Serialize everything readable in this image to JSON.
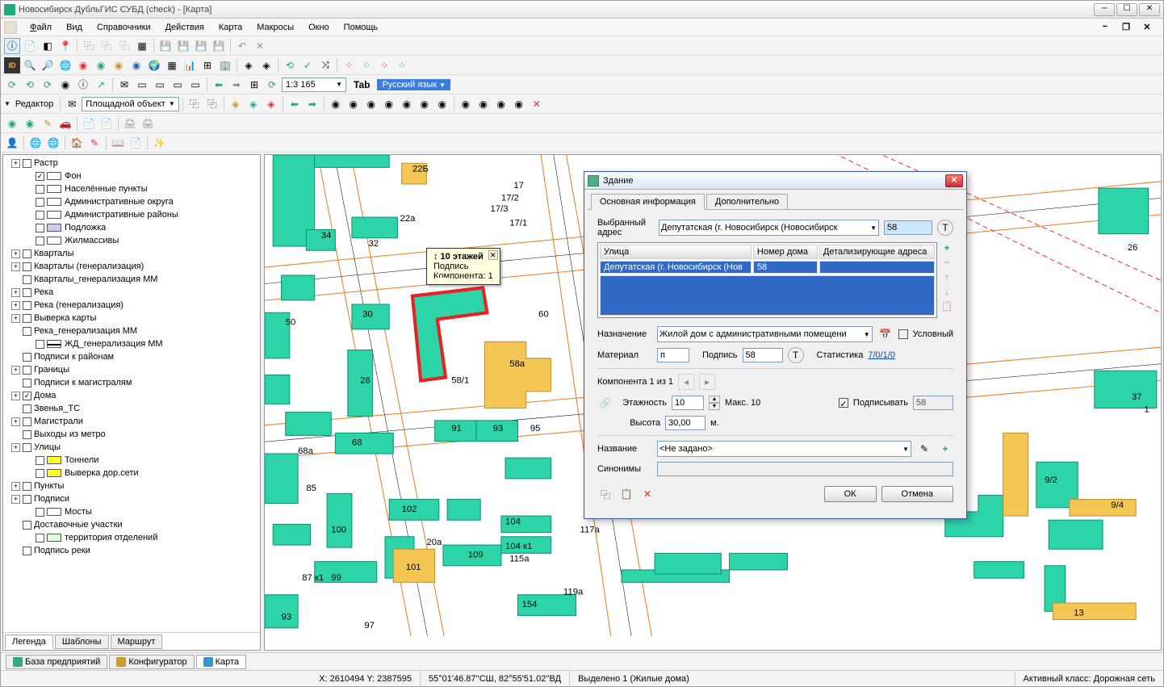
{
  "title": "Новосибирск ДубльГИС СУБД (check) - [Карта]",
  "menu": [
    "Файл",
    "Вид",
    "Справочники",
    "Действия",
    "Карта",
    "Макросы",
    "Окно",
    "Помощь"
  ],
  "editor_label": "Редактор",
  "area_object": "Площадной объект",
  "scale": "1:3 165",
  "tab_key": "Tab",
  "language": "Русский язык",
  "tooltip": {
    "title": "↕ 10 этажей",
    "l1": "Подпись",
    "l2": "Компонента: 1"
  },
  "layers": [
    {
      "exp": "+",
      "cb": "",
      "sw": "",
      "name": "Растр",
      "indent": 0
    },
    {
      "exp": "",
      "cb": "✓",
      "sw": "#fff",
      "name": "Фон",
      "indent": 1
    },
    {
      "exp": "",
      "cb": "",
      "sw": "#fff",
      "name": "Населённые пункты",
      "indent": 1
    },
    {
      "exp": "",
      "cb": "",
      "sw": "#fff",
      "name": "Административные округа",
      "indent": 1
    },
    {
      "exp": "",
      "cb": "",
      "sw": "#fff",
      "name": "Административные районы",
      "indent": 1
    },
    {
      "exp": "",
      "cb": "",
      "sw": "#cce",
      "name": "Подложка",
      "indent": 1
    },
    {
      "exp": "",
      "cb": "",
      "sw": "#fff",
      "name": "Жилмассивы",
      "indent": 1
    },
    {
      "exp": "+",
      "cb": "",
      "sw": "",
      "name": "Кварталы",
      "indent": 0
    },
    {
      "exp": "+",
      "cb": "",
      "sw": "",
      "name": "Кварталы (генерализация)",
      "indent": 0
    },
    {
      "exp": "",
      "cb": "",
      "sw": "",
      "name": "Кварталы_генерализация ММ",
      "indent": 0
    },
    {
      "exp": "+",
      "cb": "",
      "sw": "",
      "name": "Река",
      "indent": 0
    },
    {
      "exp": "+",
      "cb": "",
      "sw": "",
      "name": "Река (генерализация)",
      "indent": 0
    },
    {
      "exp": "+",
      "cb": "",
      "sw": "",
      "name": "Выверка карты",
      "indent": 0
    },
    {
      "exp": "",
      "cb": "",
      "sw": "",
      "name": "Река_генерализация ММ",
      "indent": 0
    },
    {
      "exp": "",
      "cb": "",
      "sw": "—",
      "name": "ЖД_генерализация ММ",
      "indent": 1
    },
    {
      "exp": "",
      "cb": "",
      "sw": "",
      "name": "Подписи к районам",
      "indent": 0
    },
    {
      "exp": "+",
      "cb": "",
      "sw": "",
      "name": "Границы",
      "indent": 0
    },
    {
      "exp": "",
      "cb": "",
      "sw": "",
      "name": "Подписи к магистралям",
      "indent": 0
    },
    {
      "exp": "+",
      "cb": "✓",
      "sw": "",
      "name": "Дома",
      "indent": 0
    },
    {
      "exp": "",
      "cb": "",
      "sw": "",
      "name": "Звенья_ТС",
      "indent": 0
    },
    {
      "exp": "+",
      "cb": "",
      "sw": "",
      "name": "Магистрали",
      "indent": 0
    },
    {
      "exp": "",
      "cb": "",
      "sw": "",
      "name": "Выходы из метро",
      "indent": 0
    },
    {
      "exp": "+",
      "cb": "",
      "sw": "",
      "name": "Улицы",
      "indent": 0
    },
    {
      "exp": "",
      "cb": "",
      "sw": "#ff3",
      "name": "Тоннели",
      "indent": 1
    },
    {
      "exp": "",
      "cb": "",
      "sw": "#ff3",
      "name": "Выверка дор.сети",
      "indent": 1
    },
    {
      "exp": "+",
      "cb": "",
      "sw": "",
      "name": "Пункты",
      "indent": 0
    },
    {
      "exp": "+",
      "cb": "",
      "sw": "",
      "name": "Подписи",
      "indent": 0
    },
    {
      "exp": "",
      "cb": "",
      "sw": "#fff",
      "name": "Мосты",
      "indent": 1
    },
    {
      "exp": "",
      "cb": "",
      "sw": "",
      "name": "Доставочные участки",
      "indent": 0
    },
    {
      "exp": "",
      "cb": "",
      "sw": "#dfd",
      "name": "территория отделений",
      "indent": 1
    },
    {
      "exp": "",
      "cb": "",
      "sw": "",
      "name": "Подпись реки",
      "indent": 0
    }
  ],
  "side_tabs": [
    "Легенда",
    "Шаблоны",
    "Маршрут"
  ],
  "bottom_tabs": [
    {
      "icon": "#3a7",
      "label": "База предприятий"
    },
    {
      "icon": "#c93",
      "label": "Конфигуратор"
    },
    {
      "icon": "#39c",
      "label": "Карта"
    }
  ],
  "status": {
    "xy": "X: 2610494 Y: 2387595",
    "coords": "55°01'46.87''СШ, 82°55'51.02''ВД",
    "sel": "Выделено 1 (Жилые дома)",
    "class": "Активный класс: Дорожная сеть"
  },
  "dialog": {
    "title": "Здание",
    "tabs": [
      "Основная информация",
      "Дополнительно"
    ],
    "addr_label": "Выбранный адрес",
    "addr_value": "Депутатская (г. Новосибирск (Новосибирск",
    "addr_num": "58",
    "cols": [
      "Улица",
      "Номер дома",
      "Детализирующие адреса"
    ],
    "row": {
      "street": "Депутатская (г. Новосибирск (Нов",
      "num": "58",
      "det": ""
    },
    "purpose_label": "Назначение",
    "purpose_value": "Жилой дом с административными помещени",
    "conditional": "Условный",
    "material_label": "Материал",
    "material_value": "п",
    "sign_label": "Подпись",
    "sign_value": "58",
    "stats_label": "Статистика",
    "stats_value": "7/0/1/0",
    "component": "Компонента 1 из 1",
    "floors_label": "Этажность",
    "floors_value": "10",
    "max_label": "Макс. 10",
    "subscribe": "Подписывать",
    "subscribe_val": "58",
    "height_label": "Высота",
    "height_value": "30,00",
    "height_unit": "м.",
    "name_label": "Название",
    "name_value": "<Не задано>",
    "syn_label": "Синонимы",
    "ok": "ОК",
    "cancel": "Отмена"
  },
  "map_labels": [
    "22Б",
    "17",
    "17/2",
    "17/3",
    "22а",
    "17/1",
    "34",
    "32",
    "50",
    "30",
    "26",
    "58а",
    "58/1",
    "60",
    "68",
    "68а",
    "91",
    "93",
    "95",
    "85",
    "100",
    "102",
    "20а",
    "104",
    "104 к1",
    "109",
    "115а",
    "117а",
    "101",
    "119а",
    "87 к1",
    "99",
    "93",
    "97",
    "154",
    "26",
    "37",
    "9/2",
    "9/4",
    "13",
    "1"
  ]
}
